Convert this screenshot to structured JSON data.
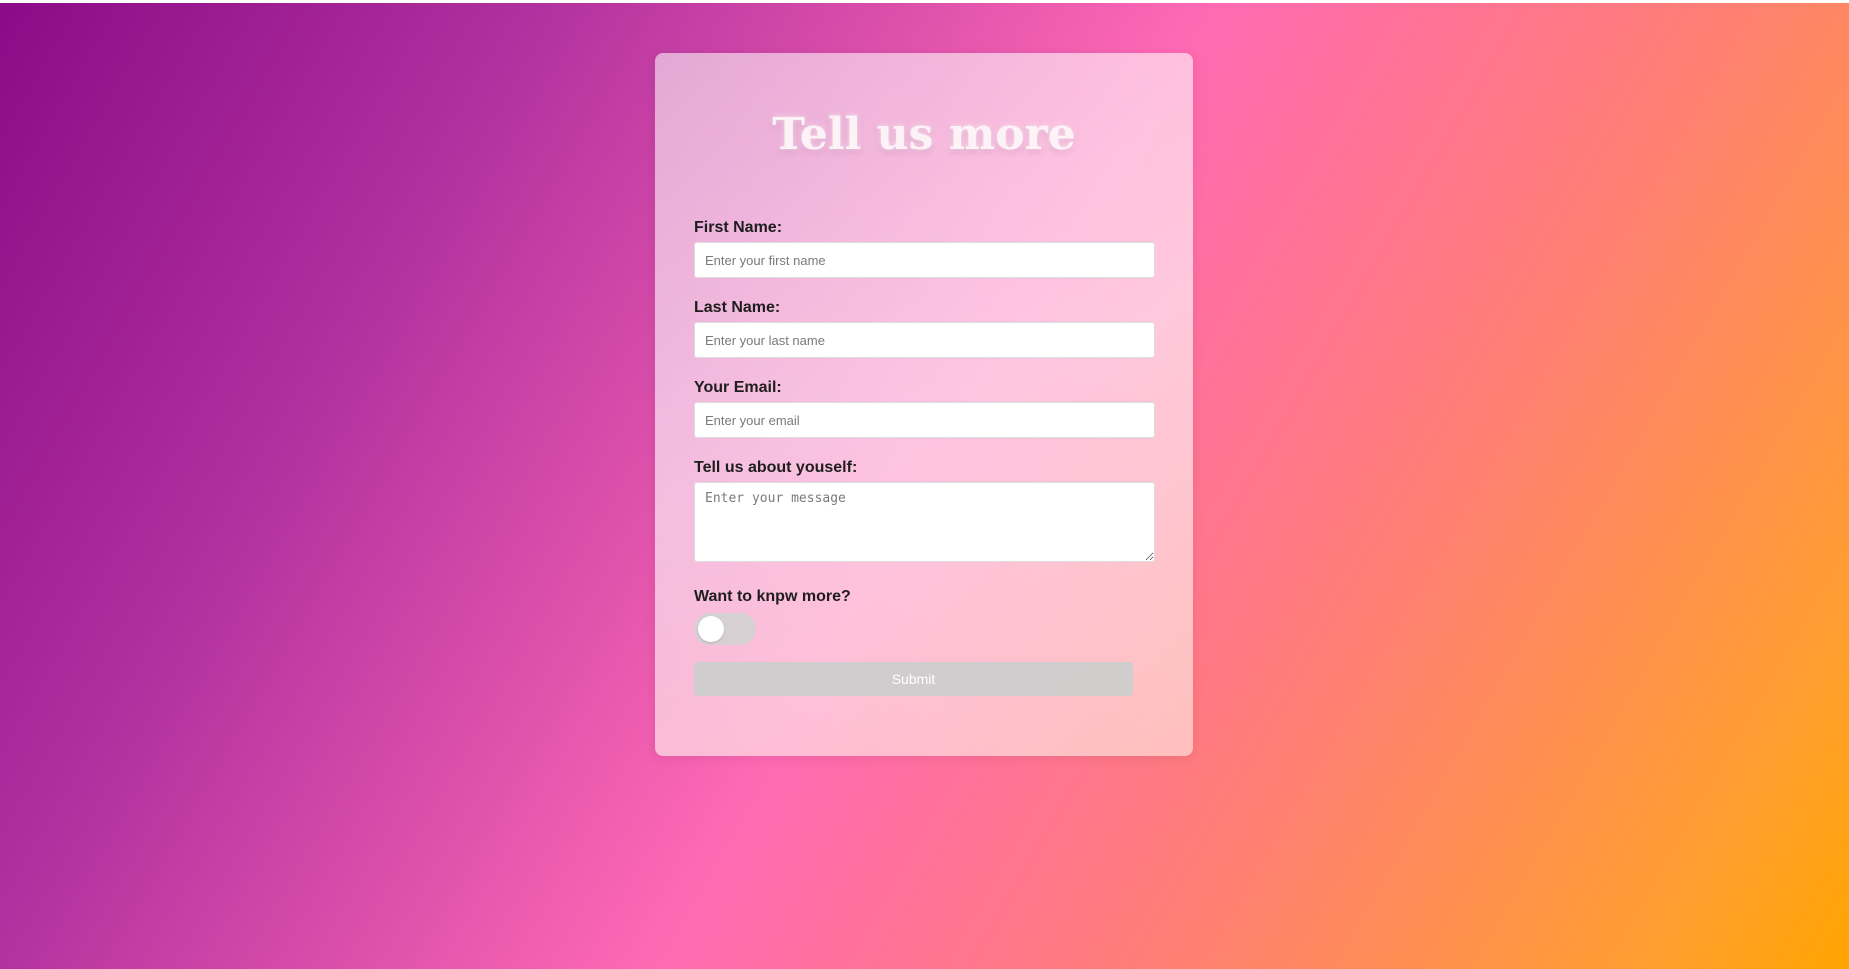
{
  "form": {
    "title": "Tell us more",
    "first_name": {
      "label": "First Name:",
      "placeholder": "Enter your first name",
      "value": ""
    },
    "last_name": {
      "label": "Last Name:",
      "placeholder": "Enter your last name",
      "value": ""
    },
    "email": {
      "label": "Your Email:",
      "placeholder": "Enter your email",
      "value": ""
    },
    "about": {
      "label": "Tell us about youself:",
      "placeholder": "Enter your message",
      "value": ""
    },
    "know_more": {
      "label": "Want to knpw more?",
      "checked": false
    },
    "submit_label": "Submit"
  },
  "colors": {
    "background_gradient": [
      "#8a0b86",
      "#ff69b4",
      "#ffa500"
    ],
    "submit_button": "#cdcdcd",
    "toggle_track": "#d2d2d2"
  }
}
